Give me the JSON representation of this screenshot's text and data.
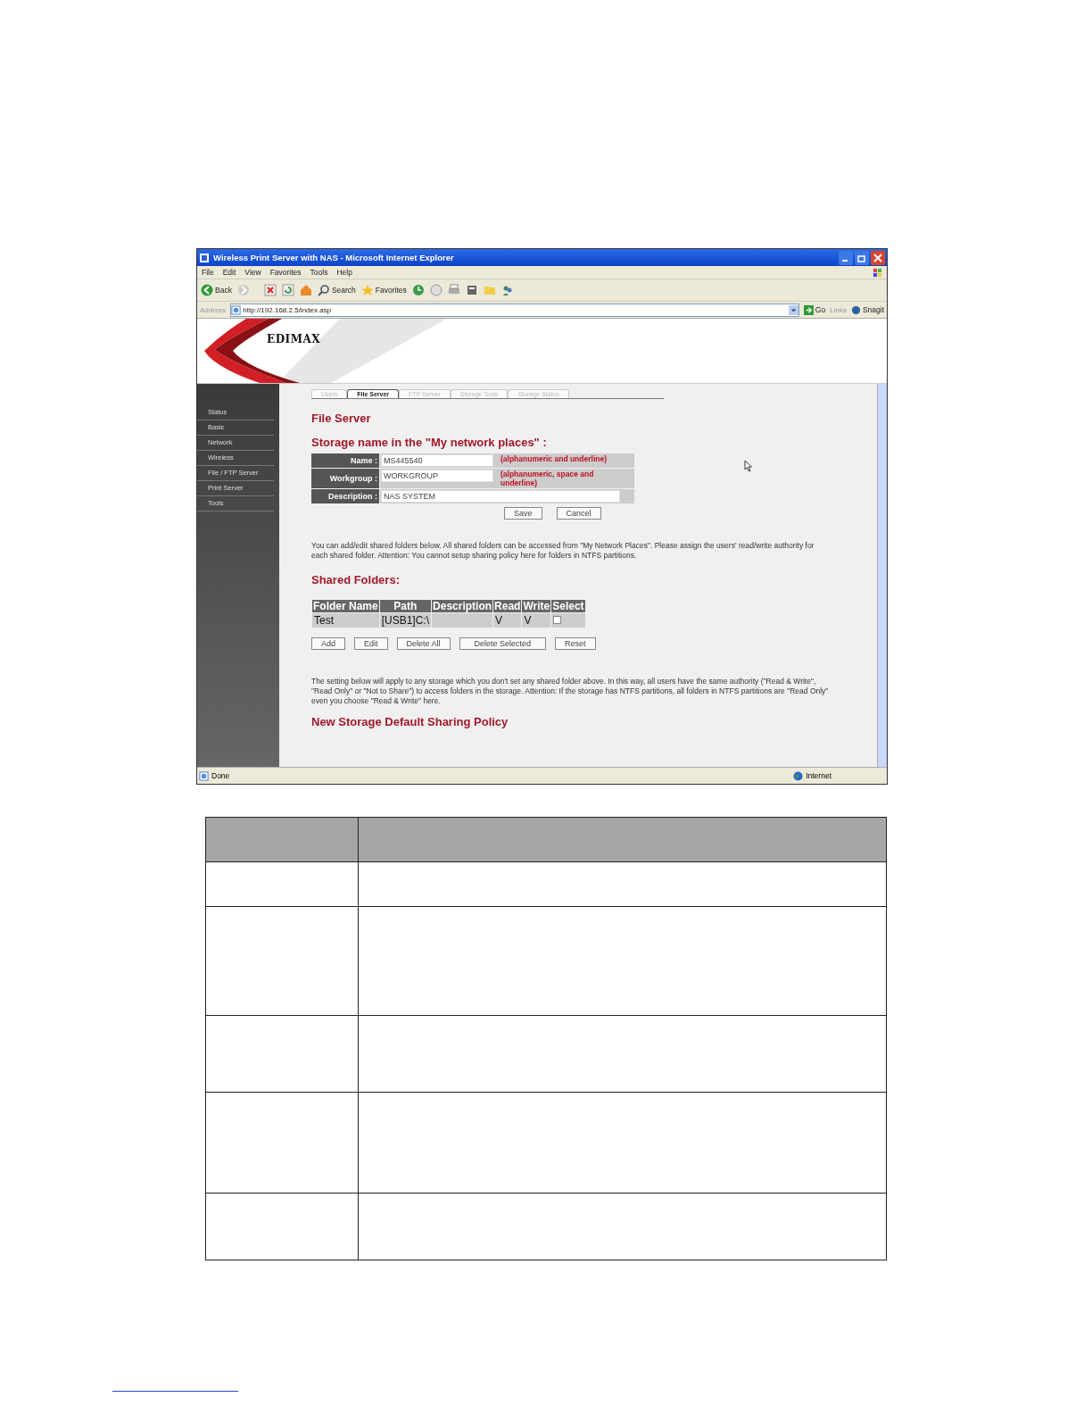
{
  "window": {
    "title": "Wireless Print Server with NAS - Microsoft Internet Explorer"
  },
  "menu": [
    "File",
    "Edit",
    "View",
    "Favorites",
    "Tools",
    "Help"
  ],
  "toolbar": {
    "back": "Back",
    "search": "Search",
    "favorites": "Favorites"
  },
  "address_bar": {
    "label": "Address",
    "url": "http://192.168.2.5/index.asp",
    "go": "Go",
    "links": "Links",
    "snagit": "Snagit"
  },
  "banner": {
    "logo": "EDIMAX"
  },
  "sidebar": {
    "items": [
      {
        "label": "Status"
      },
      {
        "label": "Basic"
      },
      {
        "label": "Network"
      },
      {
        "label": "Wireless"
      },
      {
        "label": "File / FTP Server"
      },
      {
        "label": "Print Server"
      },
      {
        "label": "Tools"
      }
    ]
  },
  "tabs": [
    {
      "label": "Users",
      "selected": false
    },
    {
      "label": "File Server",
      "selected": true
    },
    {
      "label": "FTP Server",
      "selected": false
    },
    {
      "label": "Storage Tools",
      "selected": false
    },
    {
      "label": "Storage Status",
      "selected": false
    }
  ],
  "page_title": "File Server",
  "storage_heading": "Storage name in the \"My network places\" :",
  "form": [
    {
      "label": "Name :",
      "value": "MS445540",
      "hint": "(alphanumeric and underline)",
      "kind": "short"
    },
    {
      "label": "Workgroup :",
      "value": "WORKGROUP",
      "hint": "(alphanumeric, space and underline)",
      "kind": "short"
    },
    {
      "label": "Description :",
      "value": "NAS SYSTEM",
      "kind": "long"
    }
  ],
  "form_buttons": [
    "Save",
    "Cancel"
  ],
  "intro": "You can add/edit shared folders below. All shared folders can be accessed from \"My Network Places\". Please assign the users' read/write authority for each shared folder. Attention: You cannot setup sharing policy here for folders in NTFS partitions.",
  "shared_heading": "Shared Folders:",
  "shared_table": {
    "columns": [
      "Folder Name",
      "Path",
      "Description",
      "Read",
      "Write",
      "Select"
    ],
    "rows": [
      {
        "folder_name": "Test",
        "path": "[USB1]C:\\",
        "read": "V",
        "write": "V",
        "checked": false
      }
    ]
  },
  "table_buttons": [
    "Add",
    "Edit",
    "Delete All",
    "Delete Selected",
    "Reset"
  ],
  "policy_text": "The setting below will apply to any storage which you don't set any shared folder above. In this way, all users have the same authority (\"Read & Write\", \"Read Only\" or \"Not to Share\") to access folders in the storage. Attention: If the storage has NTFS partitions, all folders in NTFS partitions are \"Read Only\" even you choose \"Read & Write\" here.",
  "policy_heading": "New Storage Default Sharing Policy",
  "status_bar": {
    "text": "Done",
    "zone": "Internet"
  }
}
